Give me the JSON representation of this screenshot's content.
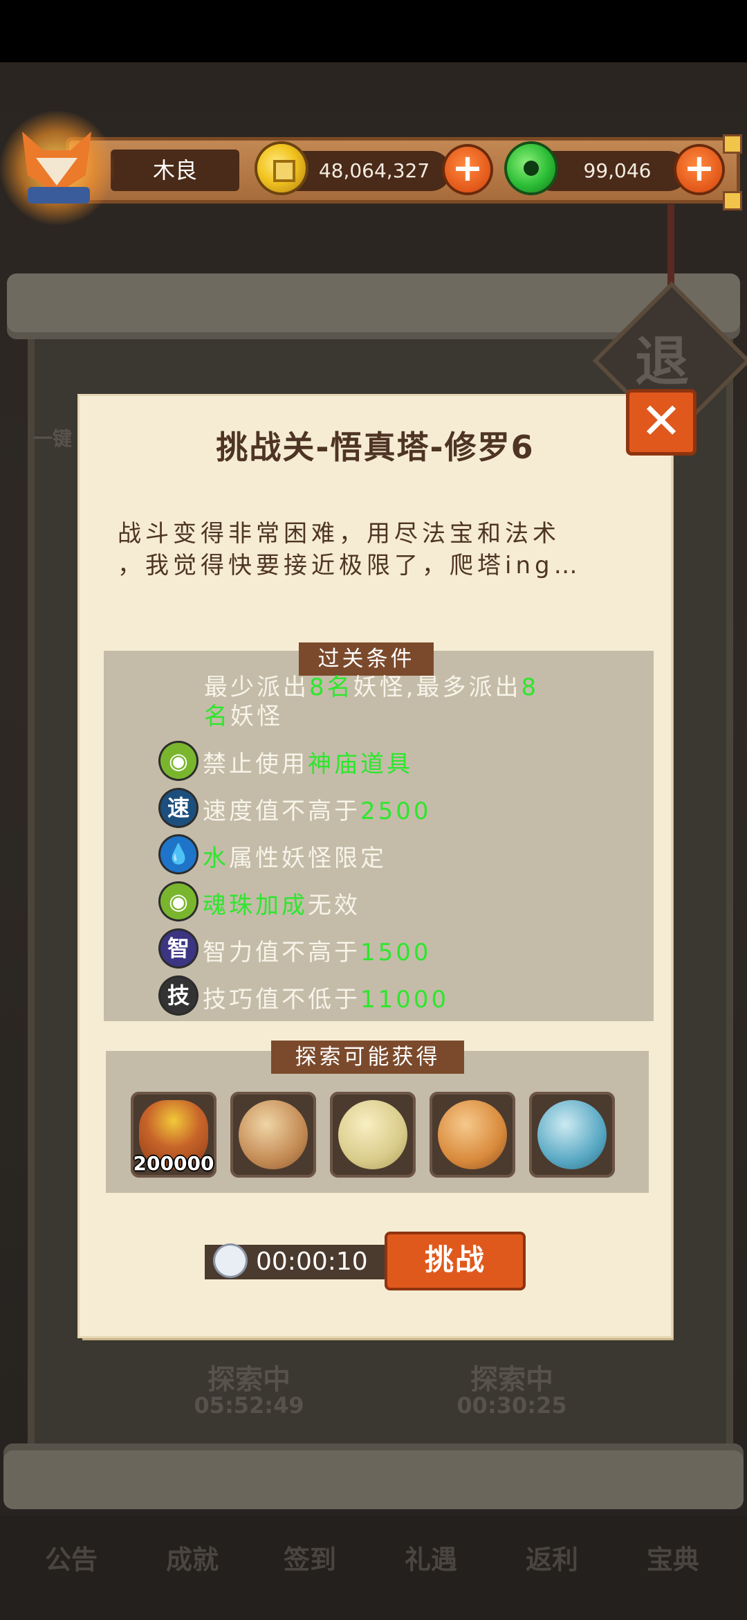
{
  "player": {
    "name": "木良"
  },
  "currency": {
    "coins": "48,064,327",
    "jade": "99,046"
  },
  "background": {
    "exit_sign": "退",
    "one_click": "一键",
    "towers": [
      {
        "status": "探索中",
        "time": "05:52:49"
      },
      {
        "status": "探索中",
        "time": "00:30:25"
      }
    ],
    "bottom_nav": [
      "公告",
      "成就",
      "签到",
      "礼遇",
      "返利",
      "宝典"
    ]
  },
  "dialog": {
    "title": "挑战关-悟真塔-修罗6",
    "description_line1": "战斗变得非常困难，用尽法宝和法术",
    "description_line2": "，我觉得快要接近极限了，爬塔ing…",
    "conditions_label": "过关条件",
    "conditions": {
      "deploy": {
        "p1": "最少派出",
        "p2": "8名",
        "p3": "妖怪,最多派出",
        "p4": "8",
        "p5": "名",
        "p6": "妖怪"
      },
      "items": [
        {
          "icon": "soul-orb-icon",
          "glyph": "◉",
          "pre": "禁止使用",
          "hl": "神庙道具",
          "post": ""
        },
        {
          "icon": "speed-icon",
          "glyph": "速",
          "pre": "速度值不高于",
          "hl": "2500",
          "post": ""
        },
        {
          "icon": "water-drop-icon",
          "glyph": "💧",
          "pre": "",
          "hl": "水",
          "post": "属性妖怪限定"
        },
        {
          "icon": "soul-orb-icon",
          "glyph": "◉",
          "pre": "",
          "hl": "魂珠加成",
          "post": "无效"
        },
        {
          "icon": "intelligence-icon",
          "glyph": "智",
          "pre": "智力值不高于",
          "hl": "1500",
          "post": ""
        },
        {
          "icon": "skill-icon",
          "glyph": "技",
          "pre": "技巧值不低于",
          "hl": "11000",
          "post": ""
        }
      ]
    },
    "rewards_label": "探索可能获得",
    "rewards": [
      {
        "icon": "gold-bag-icon",
        "count": "200000"
      },
      {
        "icon": "rock-item-icon",
        "count": ""
      },
      {
        "icon": "stone-item-icon",
        "count": ""
      },
      {
        "icon": "wood-item-icon",
        "count": ""
      },
      {
        "icon": "crystal-item-icon",
        "count": ""
      }
    ],
    "timer": "00:00:10",
    "challenge_button": "挑战",
    "close_glyph": "✕"
  },
  "colors": {
    "highlight": "#2ee62e",
    "accent_orange": "#e0591c",
    "panel": "#c4bca8",
    "parchment": "#f6ecd3"
  }
}
